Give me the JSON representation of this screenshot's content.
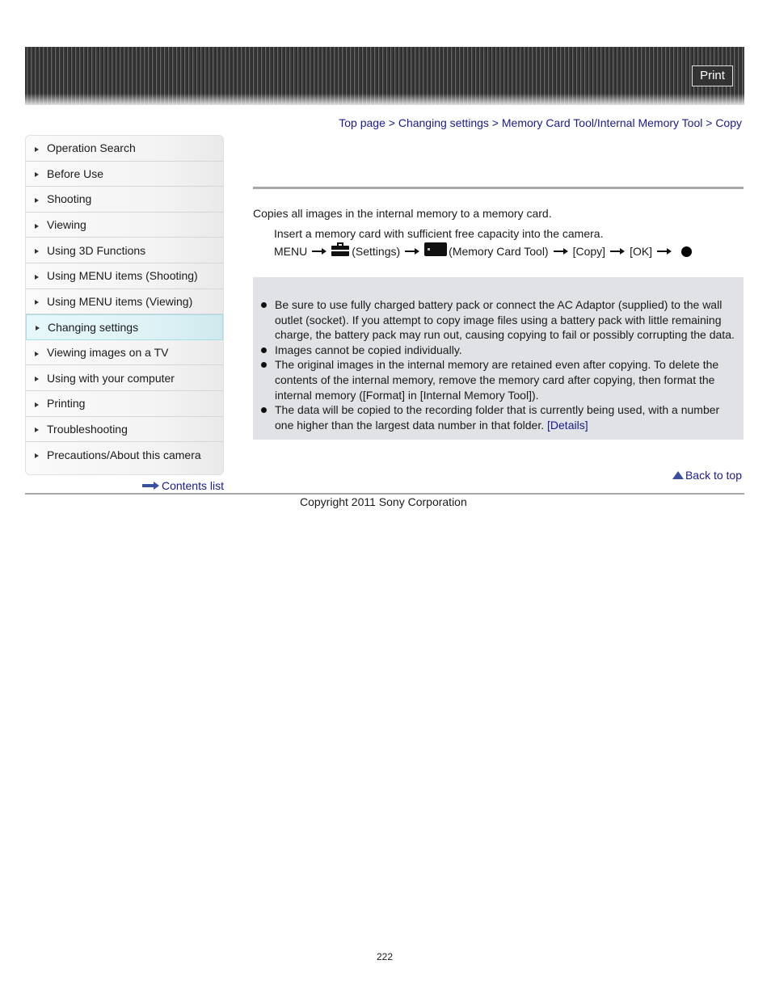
{
  "header": {
    "print_label": "Print"
  },
  "breadcrumb": {
    "items": [
      "Top page",
      "Changing settings",
      "Memory Card Tool/Internal Memory Tool",
      "Copy"
    ],
    "separator": ">"
  },
  "sidebar": {
    "active_index": 7,
    "items": [
      {
        "label": "Operation Search"
      },
      {
        "label": "Before Use"
      },
      {
        "label": "Shooting"
      },
      {
        "label": "Viewing"
      },
      {
        "label": "Using 3D Functions"
      },
      {
        "label": "Using MENU items (Shooting)"
      },
      {
        "label": "Using MENU items (Viewing)"
      },
      {
        "label": "Changing settings"
      },
      {
        "label": "Viewing images on a TV"
      },
      {
        "label": "Using with your computer"
      },
      {
        "label": "Printing"
      },
      {
        "label": "Troubleshooting"
      },
      {
        "label": "Precautions/About this camera"
      }
    ],
    "contents_link": "Contents list"
  },
  "main": {
    "intro": "Copies all images in the internal memory to a memory card.",
    "step1": "Insert a memory card with sufficient free capacity into the camera.",
    "step2": {
      "menu": "MENU",
      "settings_icon": "settings-toolbox-icon",
      "settings": "(Settings)",
      "card_icon": "memory-card-tool-icon",
      "memory_card_tool": "(Memory Card Tool)",
      "copy": "[Copy]",
      "ok": "[OK]",
      "end_icon": "center-button-dot-icon"
    },
    "notes": [
      "Be sure to use fully charged battery pack or connect the AC Adaptor (supplied) to the wall outlet (socket). If you attempt to copy image files using a battery pack with little remaining charge, the battery pack may run out, causing copying to fail or possibly corrupting the data.",
      "Images cannot be copied individually.",
      "The original images in the internal memory are retained even after copying. To delete the contents of the internal memory, remove the memory card after copying, then format the internal memory ([Format] in [Internal Memory Tool]).",
      "The data will be copied to the recording folder that is currently being used, with a number one higher than the largest data number in that folder."
    ],
    "details_link": "[Details]",
    "back_to_top": "Back to top"
  },
  "footer": {
    "copyright": "Copyright 2011 Sony Corporation",
    "page_number": "222"
  }
}
